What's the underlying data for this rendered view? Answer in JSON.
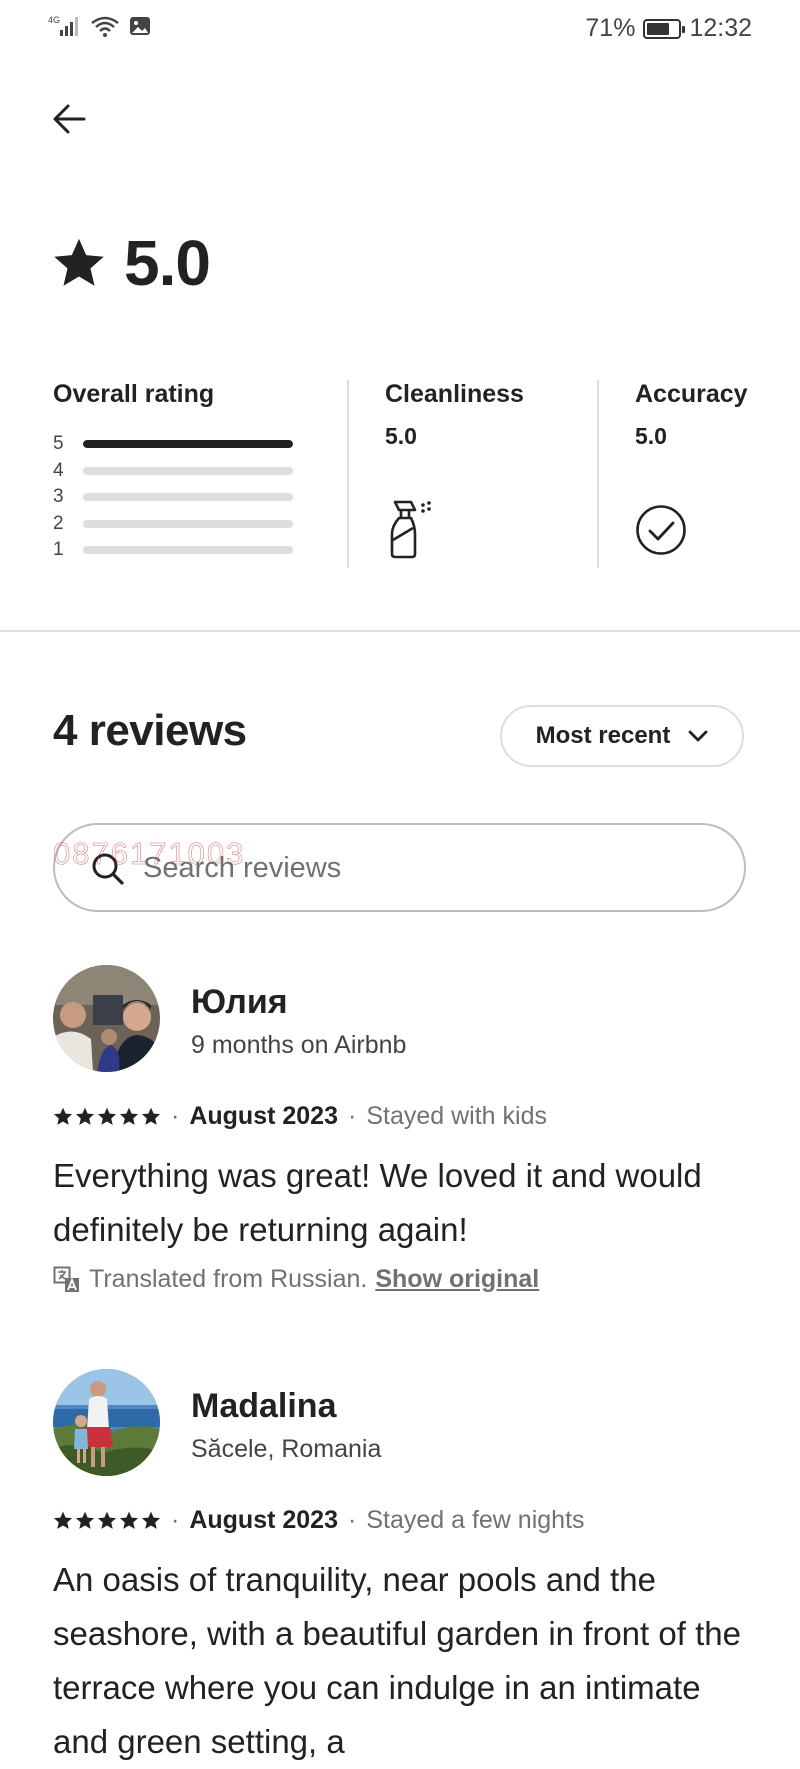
{
  "status_bar": {
    "network": "4G",
    "battery": "71%",
    "battery_level": 0.71,
    "time": "12:32"
  },
  "summary": {
    "rating": "5.0",
    "overall_label": "Overall rating",
    "distribution": [
      {
        "label": "5",
        "share": 1.0
      },
      {
        "label": "4",
        "share": 0
      },
      {
        "label": "3",
        "share": 0
      },
      {
        "label": "2",
        "share": 0
      },
      {
        "label": "1",
        "share": 0
      }
    ],
    "categories": [
      {
        "label": "Cleanliness",
        "value": "5.0",
        "icon": "spray-bottle-icon"
      },
      {
        "label": "Accuracy",
        "value": "5.0",
        "icon": "check-circle-icon"
      }
    ]
  },
  "reviews_section": {
    "title": "4 reviews",
    "sort_label": "Most recent",
    "search_placeholder": "Search reviews",
    "watermark": "0876171003"
  },
  "reviews": [
    {
      "name": "Юлия",
      "subtitle": "9 months on Airbnb",
      "stars": 5,
      "date": "August 2023",
      "trip_type": "Stayed with kids",
      "text": "Everything was great! We loved it and would definitely be returning again!",
      "translated_note": "Translated from Russian.",
      "show_original": "Show original"
    },
    {
      "name": "Madalina",
      "subtitle": "Săcele, Romania",
      "stars": 5,
      "date": "August 2023",
      "trip_type": "Stayed a few nights",
      "text": "An oasis of tranquility, near pools and the seashore, with a beautiful garden in front of the terrace where you can indulge in an intimate and green setting, a"
    }
  ],
  "colors": {
    "text": "#222222",
    "muted": "#717171",
    "divider": "#dddddd",
    "accent_watermark": "#d33a3a"
  }
}
